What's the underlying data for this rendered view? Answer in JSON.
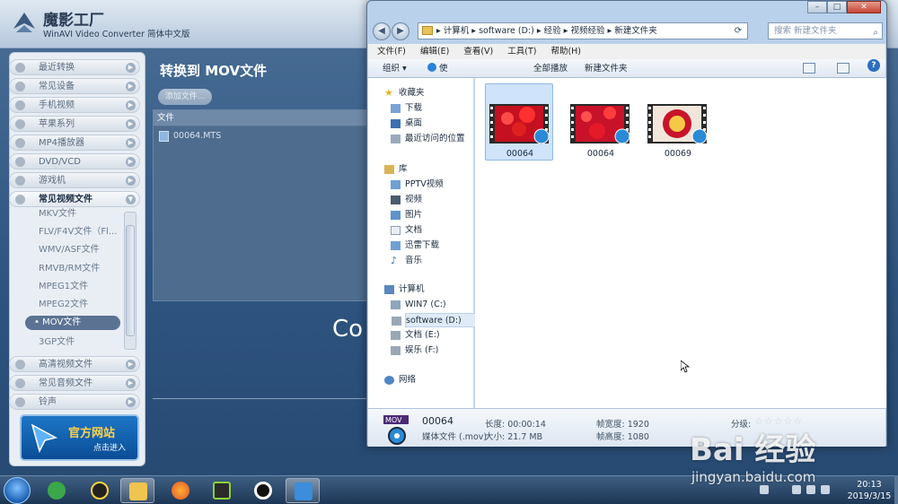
{
  "converter": {
    "app_name": "魔影工厂",
    "app_subtitle": "WinAVI Video Converter 简体中文版",
    "categories_top": [
      {
        "label": "最近转换"
      },
      {
        "label": "常见设备"
      },
      {
        "label": "手机视频"
      },
      {
        "label": "苹果系列"
      },
      {
        "label": "MP4播放器"
      },
      {
        "label": "DVD/VCD"
      },
      {
        "label": "游戏机"
      }
    ],
    "open_category": {
      "label": "常见视频文件"
    },
    "sub_items": [
      {
        "label": "MKV文件"
      },
      {
        "label": "FLV/F4V文件（Fl..."
      },
      {
        "label": "WMV/ASF文件"
      },
      {
        "label": "RMVB/RM文件"
      },
      {
        "label": "MPEG1文件"
      },
      {
        "label": "MPEG2文件"
      },
      {
        "label": "• MOV文件"
      },
      {
        "label": "3GP文件"
      }
    ],
    "categories_bottom": [
      {
        "label": "高清视频文件"
      },
      {
        "label": "常见音频文件"
      },
      {
        "label": "铃声"
      }
    ],
    "official_site": {
      "title": "官方网站",
      "action": "点击进入"
    },
    "main_title": "转换到 MOV文件",
    "add_file_label": "添加文件...",
    "file_column_header": "文件",
    "files": [
      "00064.MTS"
    ],
    "partial_text": "Co"
  },
  "explorer": {
    "breadcrumb": "▸ 计算机 ▸ software (D:) ▸ 经验 ▸ 视频经验 ▸ 新建文件夹",
    "search_placeholder": "搜索 新建文件夹",
    "menu": [
      "文件(F)",
      "编辑(E)",
      "查看(V)",
      "工具(T)",
      "帮助(H)"
    ],
    "toolbar": {
      "organize": "组织 ▾",
      "play_with": "使用QQ影音播放 ▾",
      "play_all": "全部播放",
      "new_folder": "新建文件夹"
    },
    "nav": {
      "favorites": "收藏夹",
      "favorites_items": [
        "下载",
        "桌面",
        "最近访问的位置"
      ],
      "libraries": "库",
      "library_items": [
        "PPTV视频",
        "视频",
        "图片",
        "文档",
        "迅雷下载",
        "音乐"
      ],
      "computer": "计算机",
      "drives": [
        "WIN7 (C:)",
        "software (D:)",
        "文档 (E:)",
        "娱乐 (F:)"
      ],
      "network": "网络"
    },
    "files": [
      {
        "name": "00064",
        "selected": true
      },
      {
        "name": "00064",
        "selected": false
      },
      {
        "name": "00069",
        "selected": false
      }
    ],
    "details": {
      "name": "00064",
      "type": "媒体文件 (.mov)",
      "length": "长度: 00:00:14",
      "size": "大小: 21.7 MB",
      "frame_width": "帧宽度: 1920",
      "frame_height": "帧高度: 1080",
      "rating": "分级:",
      "rating_stars": "☆☆☆☆☆"
    }
  },
  "taskbar": {
    "time": "20:13",
    "date": "2019/3/15"
  },
  "watermark": {
    "logo": "Bai 经验",
    "url": "jingyan.baidu.com"
  }
}
